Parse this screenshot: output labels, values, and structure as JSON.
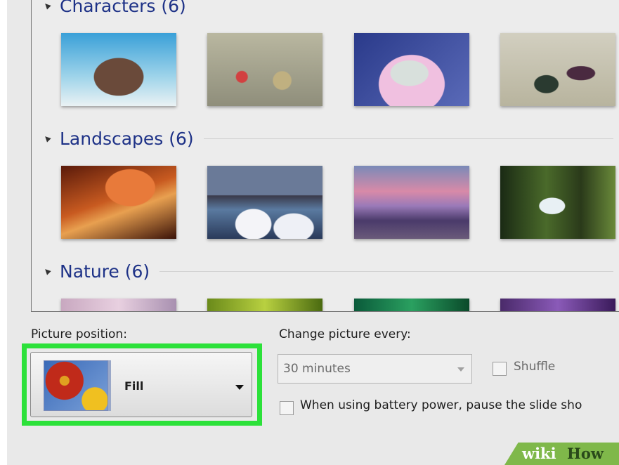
{
  "groups": [
    {
      "label": "Characters (6)"
    },
    {
      "label": "Landscapes (6)"
    },
    {
      "label": "Nature (6)"
    }
  ],
  "controls": {
    "picture_position_label": "Picture position:",
    "picture_position_value": "Fill",
    "change_every_label": "Change picture every:",
    "change_every_value": "30 minutes",
    "shuffle_label": "Shuffle",
    "battery_label": "When using battery power, pause the slide sho"
  },
  "watermark": {
    "wiki": "wiki",
    "how": "How"
  },
  "colors": {
    "highlight": "#2ce13a",
    "group_text": "#1e3287",
    "watermark_bg": "#7fb84a"
  }
}
